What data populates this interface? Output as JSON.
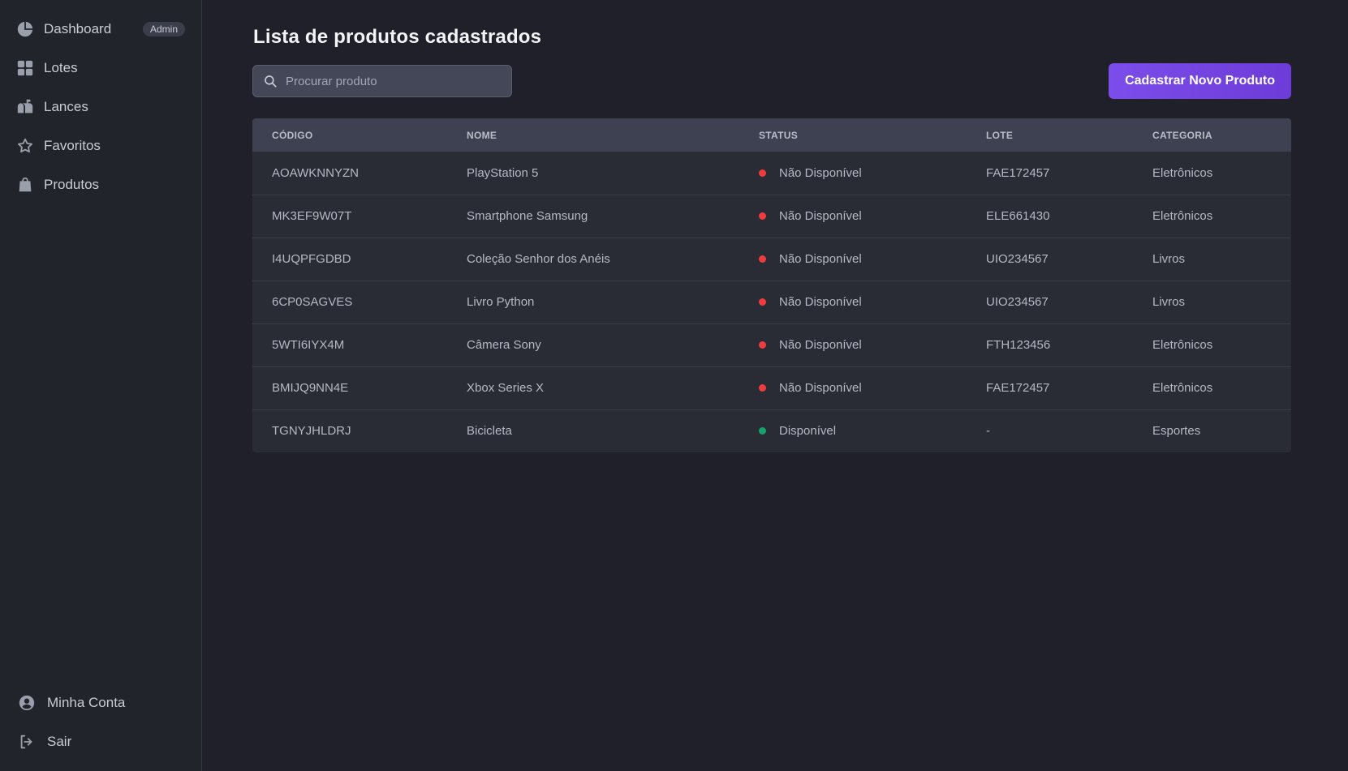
{
  "colors": {
    "accent": "#7c4dea",
    "unavailable": "#ef3d3d",
    "available": "#16a36a"
  },
  "sidebar": {
    "items": [
      {
        "label": "Dashboard",
        "icon": "pie-chart-icon",
        "badge": "Admin"
      },
      {
        "label": "Lotes",
        "icon": "grid-icon"
      },
      {
        "label": "Lances",
        "icon": "mailbox-icon"
      },
      {
        "label": "Favoritos",
        "icon": "star-icon"
      },
      {
        "label": "Produtos",
        "icon": "shopping-bag-icon"
      }
    ],
    "bottom": [
      {
        "label": "Minha Conta",
        "icon": "user-circle-icon"
      },
      {
        "label": "Sair",
        "icon": "logout-icon"
      }
    ]
  },
  "main": {
    "title": "Lista de produtos cadastrados",
    "search": {
      "placeholder": "Procurar produto",
      "value": ""
    },
    "new_button": "Cadastrar Novo Produto",
    "table": {
      "headers": [
        "CÓDIGO",
        "NOME",
        "STATUS",
        "LOTE",
        "CATEGORIA"
      ],
      "rows": [
        {
          "code": "AOAWKNNYZN",
          "name": "PlayStation 5",
          "status": "Não Disponível",
          "available": false,
          "lote": "FAE172457",
          "category": "Eletrônicos"
        },
        {
          "code": "MK3EF9W07T",
          "name": "Smartphone Samsung",
          "status": "Não Disponível",
          "available": false,
          "lote": "ELE661430",
          "category": "Eletrônicos"
        },
        {
          "code": "I4UQPFGDBD",
          "name": "Coleção Senhor dos Anéis",
          "status": "Não Disponível",
          "available": false,
          "lote": "UIO234567",
          "category": "Livros"
        },
        {
          "code": "6CP0SAGVES",
          "name": "Livro Python",
          "status": "Não Disponível",
          "available": false,
          "lote": "UIO234567",
          "category": "Livros"
        },
        {
          "code": "5WTI6IYX4M",
          "name": "Câmera Sony",
          "status": "Não Disponível",
          "available": false,
          "lote": "FTH123456",
          "category": "Eletrônicos"
        },
        {
          "code": "BMIJQ9NN4E",
          "name": "Xbox Series X",
          "status": "Não Disponível",
          "available": false,
          "lote": "FAE172457",
          "category": "Eletrônicos"
        },
        {
          "code": "TGNYJHLDRJ",
          "name": "Bicicleta",
          "status": "Disponível",
          "available": true,
          "lote": "-",
          "category": "Esportes"
        }
      ]
    }
  }
}
